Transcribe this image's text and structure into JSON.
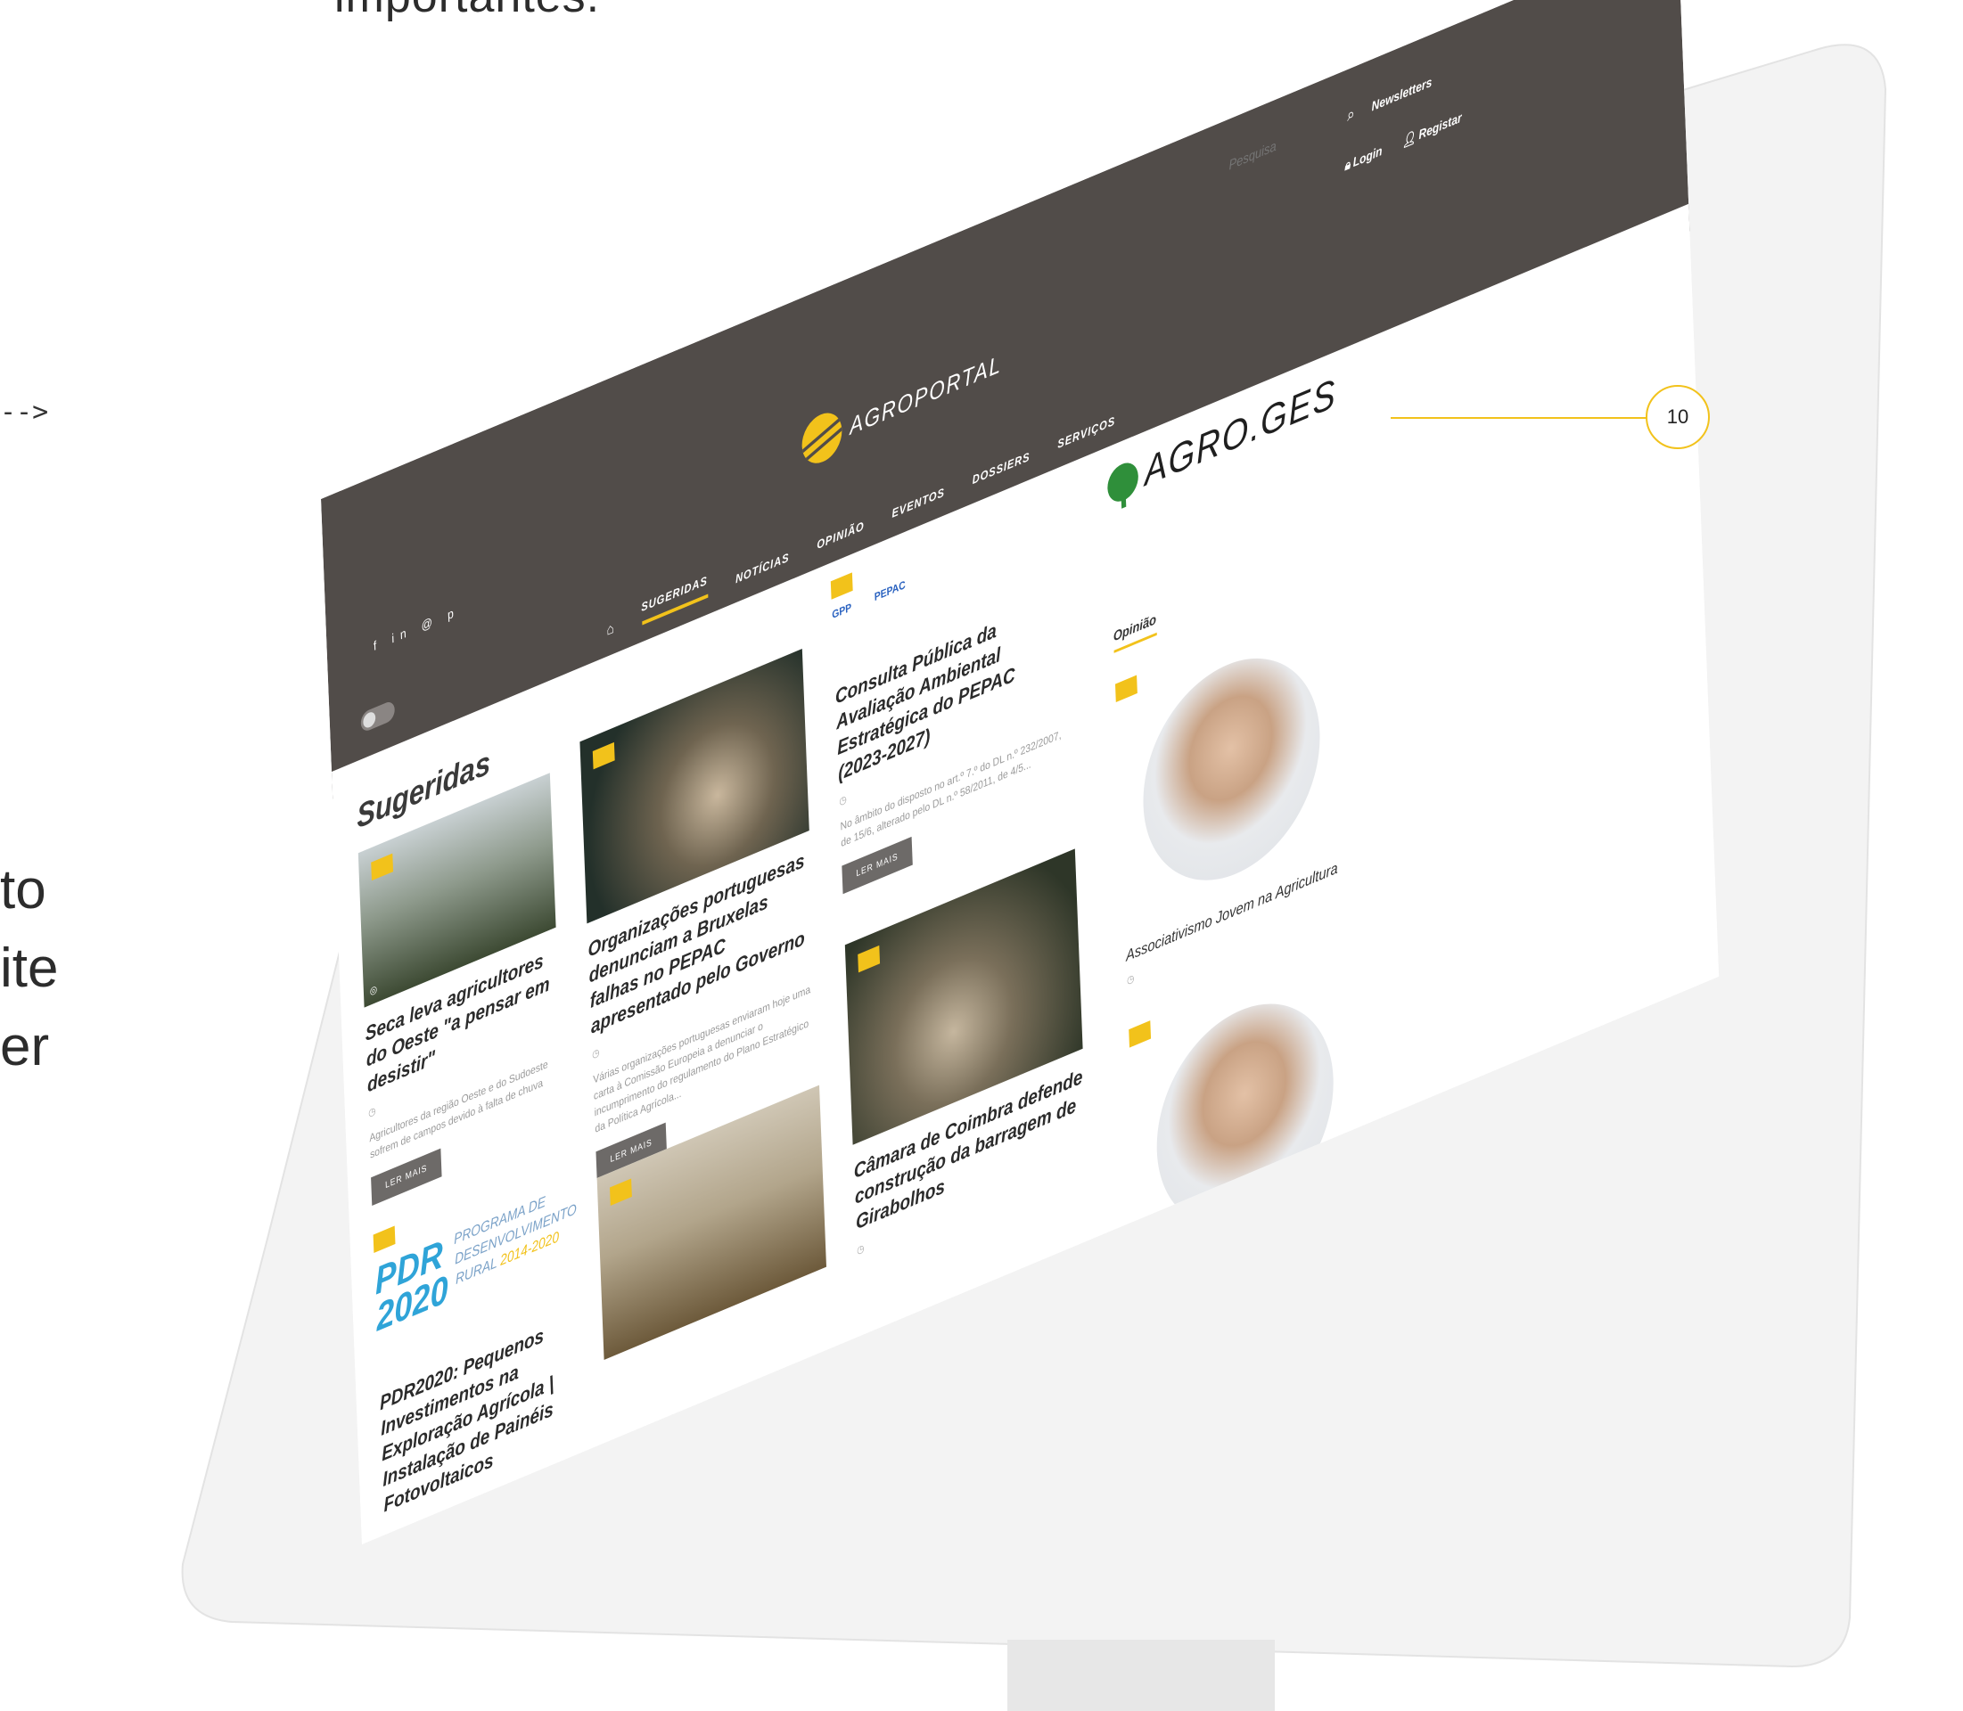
{
  "page": {
    "heading_fragment": "importantes.",
    "arrow": "-->",
    "side_text": [
      "to",
      "ite",
      "er"
    ],
    "callout_number": "10"
  },
  "topbar": {
    "social_icons": "f  in  @  p",
    "search_placeholder": "Pesquisa",
    "search_icon": "search-icon",
    "newsletter": "Newsletters",
    "login": "Login",
    "register": "Registar",
    "logo_text": "AGROPORTAL"
  },
  "nav": {
    "items": [
      {
        "label": "SUGERIDAS"
      },
      {
        "label": "NOTÍCIAS"
      },
      {
        "label": "OPINIÃO"
      },
      {
        "label": "EVENTOS"
      },
      {
        "label": "DOSSIERS"
      },
      {
        "label": "SERVIÇOS"
      }
    ]
  },
  "main": {
    "section_title": "Sugeridas",
    "read_more": "LER MAIS",
    "cards": [
      {
        "title": "Seca leva agricultores do Oeste \"a pensar em desistir\"",
        "text": "Agricultores da região Oeste e do Sudoeste sofrem de campos devido à falta de chuva"
      },
      {
        "title": "Organizações portuguesas denunciam a Bruxelas falhas no PEPAC apresentado pelo Governo",
        "text": "Várias organizações portuguesas enviaram hoje uma carta à Comissão Europeia a denunciar o incumprimento do regulamento do Plano Estratégico da Política Agrícola..."
      },
      {
        "title": "Consulta Pública da Avaliação Ambiental Estratégica do PEPAC (2023-2027)",
        "text": "No âmbito do disposto no art.º 7.º do DL n.º 232/2007, de 15/6, alterado pelo DL n.º 58/2011, de 4/5..."
      },
      {
        "title": "PDR2020: Pequenos Investimentos na Exploração Agrícola | Instalação de Painéis Fotovoltaicos"
      },
      {
        "title": "Câmara de Coimbra defende construção da barragem de Girabolhos"
      }
    ],
    "pdr": {
      "mark_line1": "PDR",
      "mark_line2": "2020",
      "text_line1": "PROGRAMA DE",
      "text_line2": "DESENVOLVIMENTO",
      "text_line3": "RURAL",
      "years": "2014-2020"
    },
    "pepac": {
      "gpp": "GPP",
      "logo": "PEPAC"
    }
  },
  "sidebar": {
    "agroges": "AGRO.GES",
    "opinion_heading": "Opinião",
    "opinion_title": "Associativismo Jovem na Agricultura"
  },
  "colors": {
    "accent": "#f2c21b",
    "header": "#514c49"
  }
}
